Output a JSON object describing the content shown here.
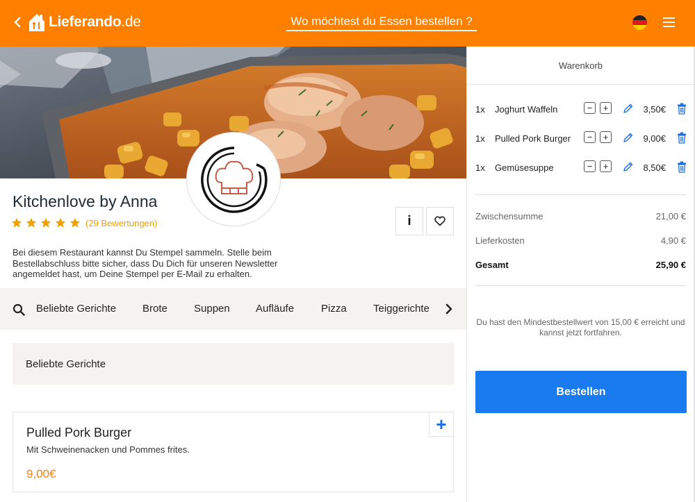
{
  "header": {
    "logo": {
      "brand": "Lieferando",
      "tld": ".de"
    },
    "title": "Wo möchtest du Essen bestellen ?"
  },
  "restaurant": {
    "name": "Kitchenlove by Anna",
    "rating": 5,
    "reviews": "(29 Bewertungen)",
    "info_label": "i",
    "description": "Bei diesem Restaurant kannst Du Stempel sammeln. Stelle beim Bestellabschluss bitte sicher, dass Du Dich für unseren Newsletter angemeldet hast, um Deine Stempel per E-Mail zu erhalten."
  },
  "categories": [
    "Beliebte Gerichte",
    "Brote",
    "Suppen",
    "Aufläufe",
    "Pizza",
    "Teiggerichte"
  ],
  "section": {
    "title": "Beliebte Gerichte"
  },
  "menu_item": {
    "name": "Pulled Pork Burger",
    "description": "Mit Schweinenacken und Pommes frites.",
    "price": "9,00€",
    "add_label": "+"
  },
  "cart": {
    "title": "Warenkorb",
    "items": [
      {
        "qty": "1x",
        "name": "Joghurt Waffeln",
        "price": "3,50€"
      },
      {
        "qty": "1x",
        "name": "Pulled Pork Burger",
        "price": "9,00€"
      },
      {
        "qty": "1x",
        "name": "Gemüsesuppe",
        "price": "8,50€"
      }
    ],
    "minus_label": "−",
    "plus_label": "+",
    "subtotal": {
      "label": "Zwischensumme",
      "value": "21,00 €"
    },
    "delivery": {
      "label": "Lieferkosten",
      "value": "4,90 €"
    },
    "total": {
      "label": "Gesamt",
      "value": "25,90 €"
    },
    "min_message": "Du hast den Mindestbestellwert von 15,00 € erreicht und kannst jetzt fortfahren.",
    "order_button": "Bestellen"
  },
  "colors": {
    "brand_orange": "#ff8000",
    "button_blue": "#1a7aef",
    "star_gold": "#f0a000",
    "icon_blue": "#1a6fe0"
  },
  "icons": {
    "back": "chevron-left-icon",
    "logo": "house-logo-icon",
    "flag": "germany-flag-icon",
    "menu": "hamburger-icon",
    "search": "search-icon",
    "more": "chevron-right-icon",
    "heart": "heart-icon",
    "chef": "chef-hat-icon",
    "edit": "pencil-icon",
    "delete": "trash-icon"
  }
}
